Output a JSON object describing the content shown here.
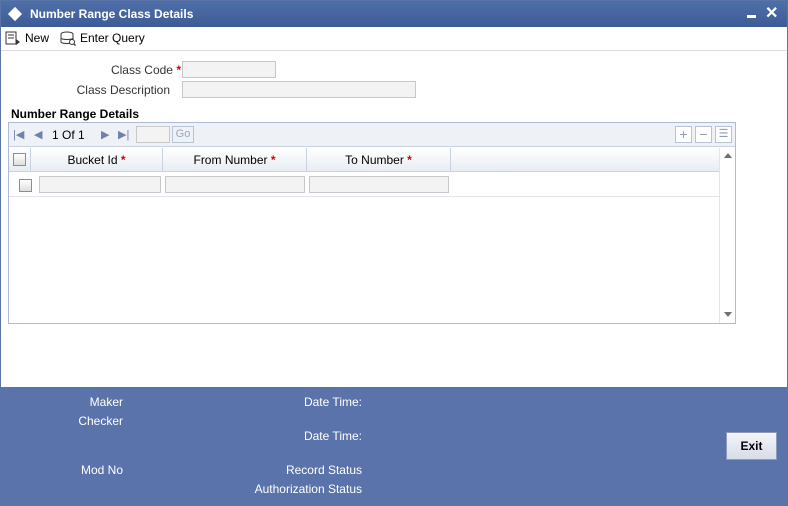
{
  "window": {
    "title": "Number Range Class Details"
  },
  "toolbar": {
    "new_label": "New",
    "enter_query_label": "Enter Query"
  },
  "form": {
    "class_code_label": "Class Code",
    "class_code_value": "",
    "class_description_label": "Class Description",
    "class_description_value": "",
    "required_marker": "*"
  },
  "grid": {
    "section_title": "Number Range Details",
    "pager": {
      "current": "1",
      "of_label": "Of",
      "total": "1"
    },
    "go_label": "Go",
    "columns": [
      {
        "label": "Bucket Id",
        "required": "*"
      },
      {
        "label": "From Number",
        "required": "*"
      },
      {
        "label": "To Number",
        "required": "*"
      }
    ],
    "rows": [
      {
        "bucket_id": "",
        "from_number": "",
        "to_number": ""
      }
    ]
  },
  "footer": {
    "maker_label": "Maker",
    "checker_label": "Checker",
    "date_time_label_1": "Date Time:",
    "date_time_label_2": "Date Time:",
    "mod_no_label": "Mod No",
    "record_status_label": "Record Status",
    "authorization_status_label": "Authorization Status",
    "exit_label": "Exit"
  },
  "colors": {
    "titlebar": "#3d5c97",
    "footer": "#5a73aa",
    "required": "#dd0000"
  }
}
